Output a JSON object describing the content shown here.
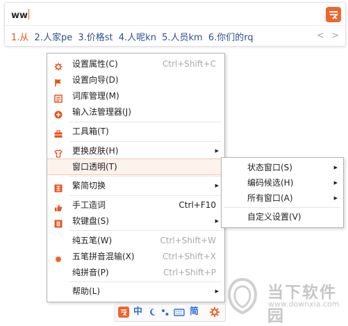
{
  "ime": {
    "composition": "ww",
    "candidates": [
      "1.从",
      "2.人家pe",
      "3.价格st",
      "4.人呢kn",
      "5.人员km",
      "6.你们的rq"
    ],
    "prev_page": "<",
    "next_page": ">"
  },
  "menu": {
    "items": [
      {
        "label": "设置属性(C)",
        "shortcut": "Ctrl+Shift+C",
        "icon": "gear-icon"
      },
      {
        "label": "设置向导(D)",
        "icon": "flag-icon"
      },
      {
        "label": "词库管理(M)",
        "icon": "dictionary-icon"
      },
      {
        "label": "输入法管理器(J)",
        "icon": "ime-manager-icon"
      },
      {
        "label": "工具箱(T)",
        "icon": "toolbox-icon"
      },
      {
        "label": "更换皮肤(H)",
        "icon": "shirt-icon"
      },
      {
        "label": "窗口透明(T)"
      },
      {
        "label": "繁简切换",
        "icon": "traditional-simplified-icon"
      },
      {
        "label": "手工造词",
        "shortcut": "Ctrl+F10",
        "icon": "thumb-icon"
      },
      {
        "label": "软键盘(S)",
        "icon": "soft-keyboard-icon"
      },
      {
        "label": "纯五笔(W)",
        "shortcut": "Ctrl+Shift+W"
      },
      {
        "label": "五笔拼音混输(X)",
        "shortcut": "Ctrl+Shift+X",
        "icon": "radio-dot-icon"
      },
      {
        "label": "纯拼音(P)",
        "shortcut": "Ctrl+Shift+P"
      },
      {
        "label": "帮助(L)"
      }
    ]
  },
  "submenu": {
    "items": [
      {
        "label": "状态窗口(S)"
      },
      {
        "label": "编码候选(H)"
      },
      {
        "label": "所有窗口(A)"
      },
      {
        "label": "自定义设置(V)"
      }
    ]
  },
  "status_bar": {
    "mode": "中",
    "script": "简"
  },
  "watermark": {
    "title": "当下软件园",
    "url": "www.downxia.com"
  },
  "colors": {
    "accent": "#f0642d",
    "candidate_blue": "#2f4f93",
    "highlight": "#fdf2ec"
  }
}
